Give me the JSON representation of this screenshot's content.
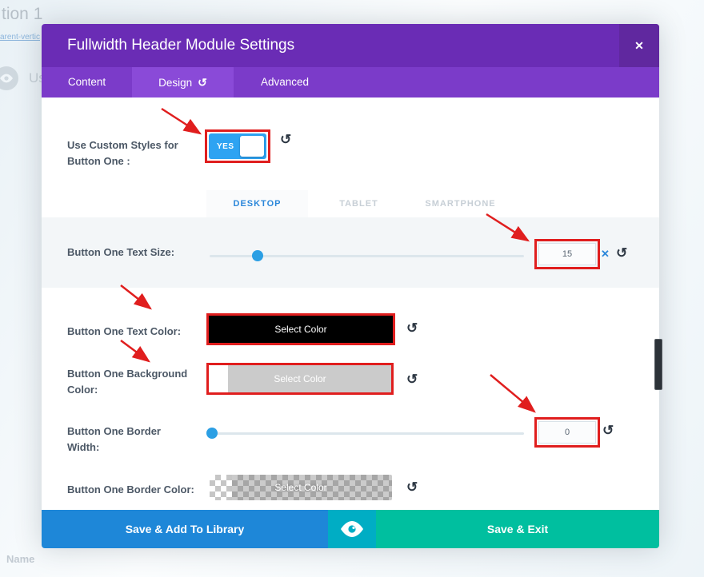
{
  "background": {
    "partial_heading": "tion 1",
    "partial_link": "arent-vertic",
    "partial_label": "Us",
    "name_label": "Name"
  },
  "modal": {
    "title": "Fullwidth Header Module Settings",
    "tabs": [
      {
        "label": "Content"
      },
      {
        "label": "Design"
      },
      {
        "label": "Advanced"
      }
    ],
    "device_tabs": [
      {
        "label": "DESKTOP"
      },
      {
        "label": "TABLET"
      },
      {
        "label": "SMARTPHONE"
      }
    ],
    "settings": {
      "custom_styles": {
        "label": "Use Custom Styles for Button One :",
        "value": "YES"
      },
      "text_size": {
        "label": "Button One Text Size:",
        "value": "15"
      },
      "text_color": {
        "label": "Button One Text Color:",
        "button_label": "Select Color",
        "swatch": "#000000"
      },
      "background_color": {
        "label": "Button One Background Color:",
        "button_label": "Select Color",
        "swatch": "#cccccc"
      },
      "border_width": {
        "label": "Button One Border Width:",
        "value": "0"
      },
      "border_color": {
        "label": "Button One Border Color:",
        "button_label": "Select Color",
        "swatch": "transparent"
      }
    },
    "footer": {
      "save_library": "Save & Add To Library",
      "save_exit": "Save & Exit"
    }
  },
  "icons": {
    "close": "✕",
    "undo": "↺",
    "clear": "✕"
  },
  "colors": {
    "annotation_red": "#e01e1e",
    "header_purple": "#6a2cb5",
    "tabbar_purple": "#7b3bc9",
    "active_tab_purple": "#8a4ad8",
    "accent_blue": "#2b87da",
    "toggle_blue": "#2ea3f2",
    "footer_blue": "#1e87d8",
    "footer_teal": "#00adc4",
    "footer_green": "#00bf9f"
  }
}
